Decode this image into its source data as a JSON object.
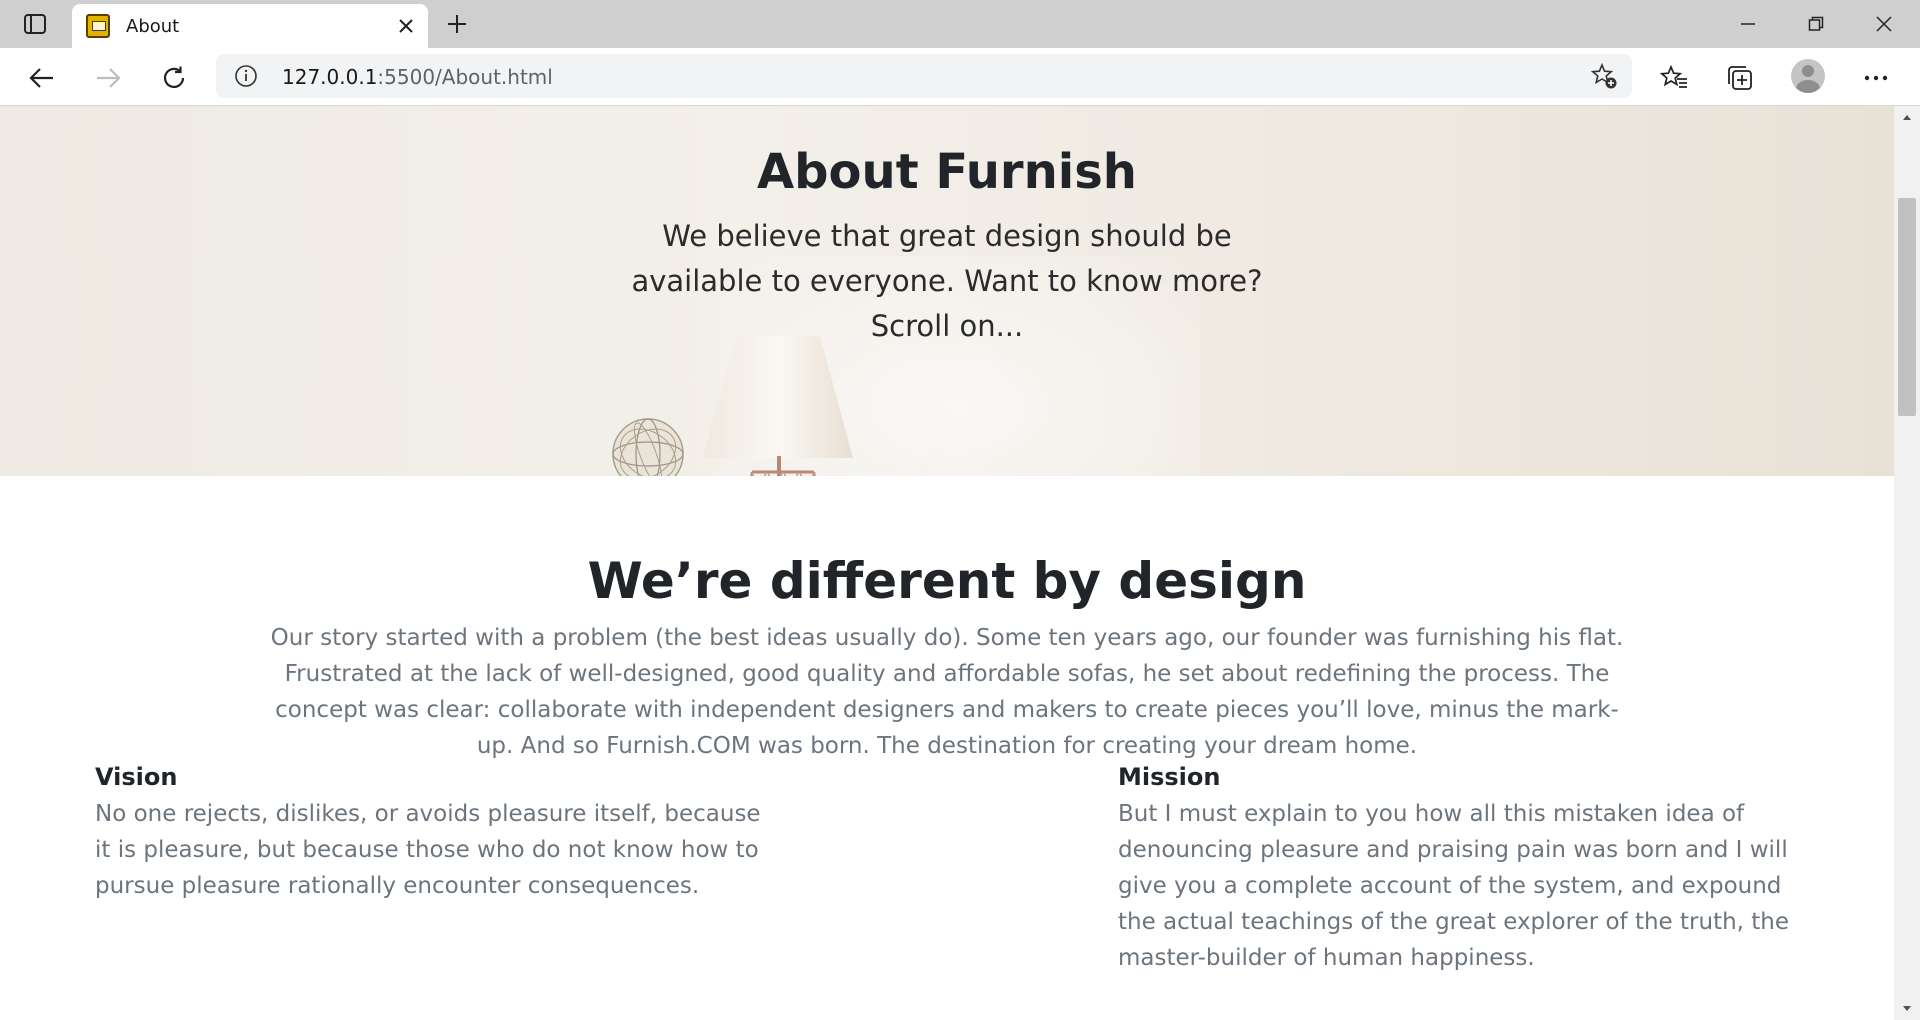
{
  "browser": {
    "tab_title": "About",
    "url_host": "127.0.0.1",
    "url_path": ":5500/About.html"
  },
  "hero": {
    "title": "About Furnish",
    "subtitle": "We believe that great design should be available to everyone. Want to know more? Scroll on..."
  },
  "story": {
    "title": "We’re different by design",
    "body": "Our story started with a problem (the best ideas usually do). Some ten years ago, our founder was furnishing his flat. Frustrated at the lack of well-designed, good quality and affordable sofas, he set about redefining the process. The concept was clear: collaborate with independent designers and makers to create pieces you’ll love, minus the mark-up. And so Furnish.COM was born. The destination for creating your dream home."
  },
  "vision": {
    "heading": "Vision",
    "text": "No one rejects, dislikes, or avoids pleasure itself, because it is pleasure, but because those who do not know how to pursue pleasure rationally encounter consequences."
  },
  "mission": {
    "heading": "Mission",
    "text": "But I must explain to you how all this mistaken idea of denouncing pleasure and praising pain was born and I will give you a complete account of the system, and expound the actual teachings of the great explorer of the truth, the master-builder of human happiness."
  },
  "icons": {
    "tab_actions": "tab-actions-icon",
    "favicon": "favicon-icon",
    "close": "close-icon",
    "new_tab": "plus-icon",
    "back": "back-arrow-icon",
    "forward": "forward-arrow-icon",
    "refresh": "refresh-icon",
    "info": "info-icon",
    "add_favorite": "star-plus-icon",
    "favorites": "favorites-icon",
    "collections": "collections-icon",
    "more": "more-icon"
  }
}
